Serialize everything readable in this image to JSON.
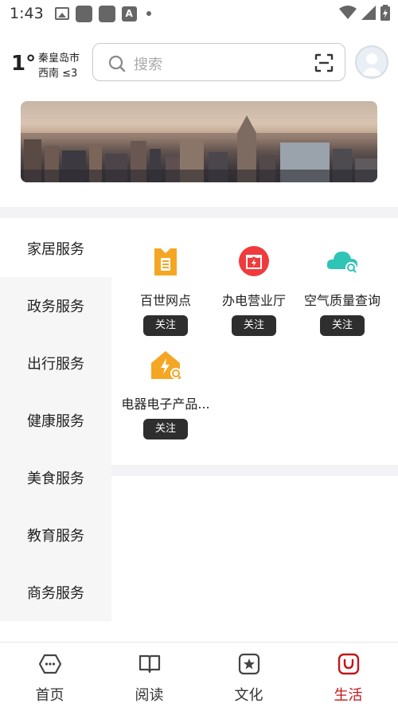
{
  "status_bar": {
    "time": "1:43",
    "icons": [
      "image-icon",
      "app-square-icon",
      "app-square-icon",
      "font-a-icon",
      "dot-icon",
      "wifi-icon",
      "signal-icon",
      "battery-icon"
    ]
  },
  "header": {
    "temperature": "1°",
    "city": "秦皇岛市",
    "wind": "西南 ≤3",
    "search_placeholder": "搜索"
  },
  "categories": [
    {
      "label": "家居服务",
      "active": true
    },
    {
      "label": "政务服务",
      "active": false
    },
    {
      "label": "出行服务",
      "active": false
    },
    {
      "label": "健康服务",
      "active": false
    },
    {
      "label": "美食服务",
      "active": false
    },
    {
      "label": "教育服务",
      "active": false
    },
    {
      "label": "商务服务",
      "active": false
    }
  ],
  "services": [
    {
      "name": "百世网点",
      "follow": "关注",
      "icon": "express-box-icon",
      "color": "#f5a623"
    },
    {
      "name": "办电营业厅",
      "follow": "关注",
      "icon": "power-hall-icon",
      "color": "#ef3b3b"
    },
    {
      "name": "空气质量查询",
      "follow": "关注",
      "icon": "air-quality-icon",
      "color": "#2ec4b6"
    },
    {
      "name": "电器电子产品...",
      "follow": "关注",
      "icon": "electric-home-icon",
      "color": "#f5a623"
    }
  ],
  "bottom_nav": [
    {
      "label": "首页",
      "icon": "home-icon",
      "active": false
    },
    {
      "label": "阅读",
      "icon": "book-icon",
      "active": false
    },
    {
      "label": "文化",
      "icon": "star-culture-icon",
      "active": false
    },
    {
      "label": "生活",
      "icon": "bag-life-icon",
      "active": true
    }
  ],
  "colors": {
    "accent": "#c3161c",
    "follow_button": "#2e2e2e"
  }
}
